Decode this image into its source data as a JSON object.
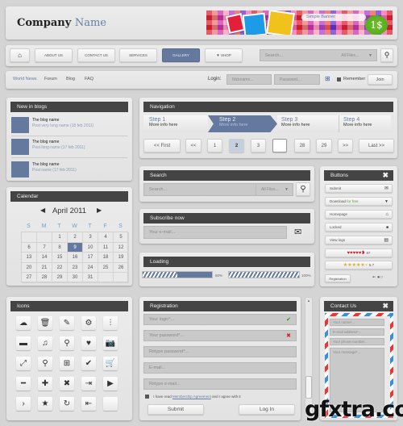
{
  "header": {
    "logo_part1": "Company",
    "logo_part2": "Name",
    "banner_label": "Simple Banner",
    "banner_price": "1$"
  },
  "menu": {
    "items": [
      "ABOUT US",
      "CONTACT US",
      "SERVICES",
      "GALLERY",
      "▼ SHOP"
    ],
    "active": "GALLERY",
    "search_placeholder": "Search...",
    "search_scope": "All Files...",
    "home_icon": "home-icon",
    "search_icon": "search-icon"
  },
  "loginbar": {
    "links": [
      "World News",
      "Forum",
      "Blog",
      "FAQ"
    ],
    "login_label": "Login:",
    "nickname_placeholder": "Nickname...",
    "password_placeholder": "Password...",
    "remember_label": "Remember",
    "join_label": "Join"
  },
  "blogs": {
    "title": "New in blogs",
    "items": [
      {
        "name": "The blog name",
        "post": "Post very long name (18 feb 2011)"
      },
      {
        "name": "The blog name",
        "post": "Post long name (17 feb 2011)"
      },
      {
        "name": "The blog name",
        "post": "Post name (17 feb 2011)"
      }
    ]
  },
  "navigation": {
    "title": "Navigation",
    "steps": [
      {
        "label": "Step 1",
        "info": "More info here"
      },
      {
        "label": "Step 2",
        "info": "More info here"
      },
      {
        "label": "Step 3",
        "info": "More info here"
      },
      {
        "label": "Step 4",
        "info": "More info here"
      }
    ],
    "active_step": 2,
    "pagination": [
      "<< First",
      "<<",
      "1",
      "2",
      "3",
      "",
      "28",
      "29",
      ">>",
      "Last >>"
    ],
    "current_page": "2"
  },
  "calendar": {
    "title": "Calendar",
    "month": "April 2011",
    "weekdays": [
      "S",
      "M",
      "T",
      "W",
      "T",
      "F",
      "S"
    ],
    "weeks": [
      [
        "",
        "",
        "1",
        "2",
        "3",
        "4",
        "5"
      ],
      [
        "6",
        "7",
        "8",
        "9",
        "10",
        "11",
        "12"
      ],
      [
        "13",
        "14",
        "15",
        "16",
        "17",
        "18",
        "19"
      ],
      [
        "20",
        "21",
        "22",
        "23",
        "24",
        "25",
        "26"
      ],
      [
        "27",
        "28",
        "29",
        "30",
        "31",
        "",
        ""
      ]
    ],
    "selected": "9"
  },
  "search": {
    "title": "Search",
    "placeholder": "Search...",
    "scope": "All Files..."
  },
  "subscribe": {
    "title": "Subscribe now",
    "placeholder": "Your e-mail..."
  },
  "loading": {
    "title": "Loading",
    "bars": [
      {
        "percent": 50,
        "label": "50%"
      },
      {
        "percent": 100,
        "label": "100%"
      }
    ]
  },
  "buttons": {
    "title": "Buttons",
    "items": [
      {
        "label": "Submit",
        "icon": "envelope-icon",
        "glyph": "✉"
      },
      {
        "label": "Download for free",
        "icon": "chevron-down-icon",
        "glyph": "▼"
      },
      {
        "label": "Homepage",
        "icon": "home-icon",
        "glyph": "⌂"
      },
      {
        "label": "Locked",
        "icon": "lock-icon",
        "glyph": "🔒"
      },
      {
        "label": "View logs",
        "icon": "document-icon",
        "glyph": "▤"
      }
    ],
    "hearts_rating": "87",
    "stars_rating": "5.7",
    "registration_label": "Registration"
  },
  "icons": {
    "title": "Icons",
    "grid": [
      [
        "cloud-upload-icon",
        "trash-icon",
        "pencil-icon",
        "gear-icon",
        "sliders-icon"
      ],
      [
        "comment-icon",
        "music-icon",
        "search-icon",
        "heart-icon",
        "camera-icon"
      ],
      [
        "expand-icon",
        "map-pin-icon",
        "sitemap-icon",
        "check-icon",
        "cart-icon"
      ],
      [
        "minus-icon",
        "plus-icon",
        "close-icon",
        "logout-icon",
        "play-icon"
      ],
      [
        "chevron-right-icon",
        "star-icon",
        "refresh-icon",
        "login-icon",
        "blank-icon"
      ]
    ],
    "glyphs": [
      [
        "☁",
        "🗑",
        "✎",
        "⚙",
        "⫶"
      ],
      [
        "▬",
        "♫",
        "⚲",
        "♥",
        "📷"
      ],
      [
        "⤢",
        "⚲",
        "⊞",
        "✔",
        "🛒"
      ],
      [
        "━",
        "✚",
        "✖",
        "⇥",
        "▶"
      ],
      [
        "›",
        "★",
        "↻",
        "⇤",
        ""
      ]
    ]
  },
  "registration": {
    "title": "Registration",
    "fields": [
      {
        "placeholder": "Your login*...",
        "status": "valid"
      },
      {
        "placeholder": "Your password*...",
        "status": "invalid"
      },
      {
        "placeholder": "Retype password*...",
        "status": ""
      },
      {
        "placeholder": "E-mail...",
        "status": ""
      },
      {
        "placeholder": "Retype e-mail...",
        "status": ""
      }
    ],
    "agree_prefix": "I have read",
    "agree_link": "Membership Agreement",
    "agree_suffix": "and I agree with it",
    "submit_label": "Submit",
    "login_label": "Log In"
  },
  "contact": {
    "title": "Contact Us",
    "name_placeholder": "Your name*...",
    "email_placeholder": "E-mail address*...",
    "phone_placeholder": "Your phone number...",
    "message_placeholder": "Your message*..."
  },
  "watermark": "gfxtra.com"
}
